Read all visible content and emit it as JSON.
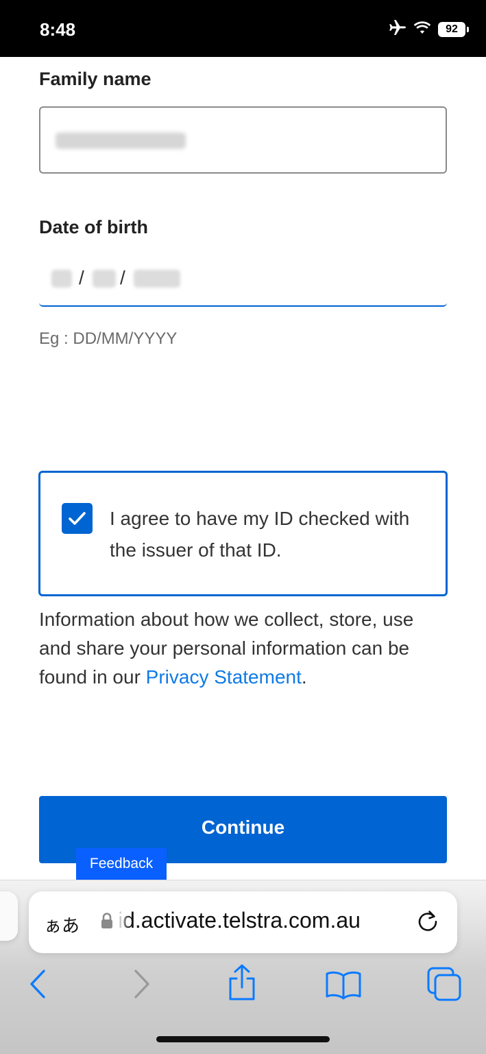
{
  "status_bar": {
    "time": "8:48",
    "battery": "92"
  },
  "form": {
    "family_name_label": "Family name",
    "dob_label": "Date of birth",
    "dob_hint": "Eg : DD/MM/YYYY",
    "dob_separator": "/"
  },
  "consent": {
    "text": "I agree to have my ID checked with the issuer of that ID.",
    "checked": true
  },
  "info": {
    "text_before": "Information about how we collect, store, use and share your personal information can be found in our ",
    "link_text": "Privacy Statement",
    "text_after": "."
  },
  "buttons": {
    "continue_label": "Continue",
    "feedback_label": "Feedback"
  },
  "browser": {
    "aa_label": "ぁあ",
    "url": "id.activate.telstra.com.au",
    "icons": [
      "back-icon",
      "forward-icon",
      "share-icon",
      "bookmarks-icon",
      "tabs-icon",
      "reload-icon",
      "lock-icon"
    ]
  },
  "colors": {
    "accent": "#0064d2",
    "link": "#0f7ae5",
    "feedback": "#0a5fff"
  }
}
